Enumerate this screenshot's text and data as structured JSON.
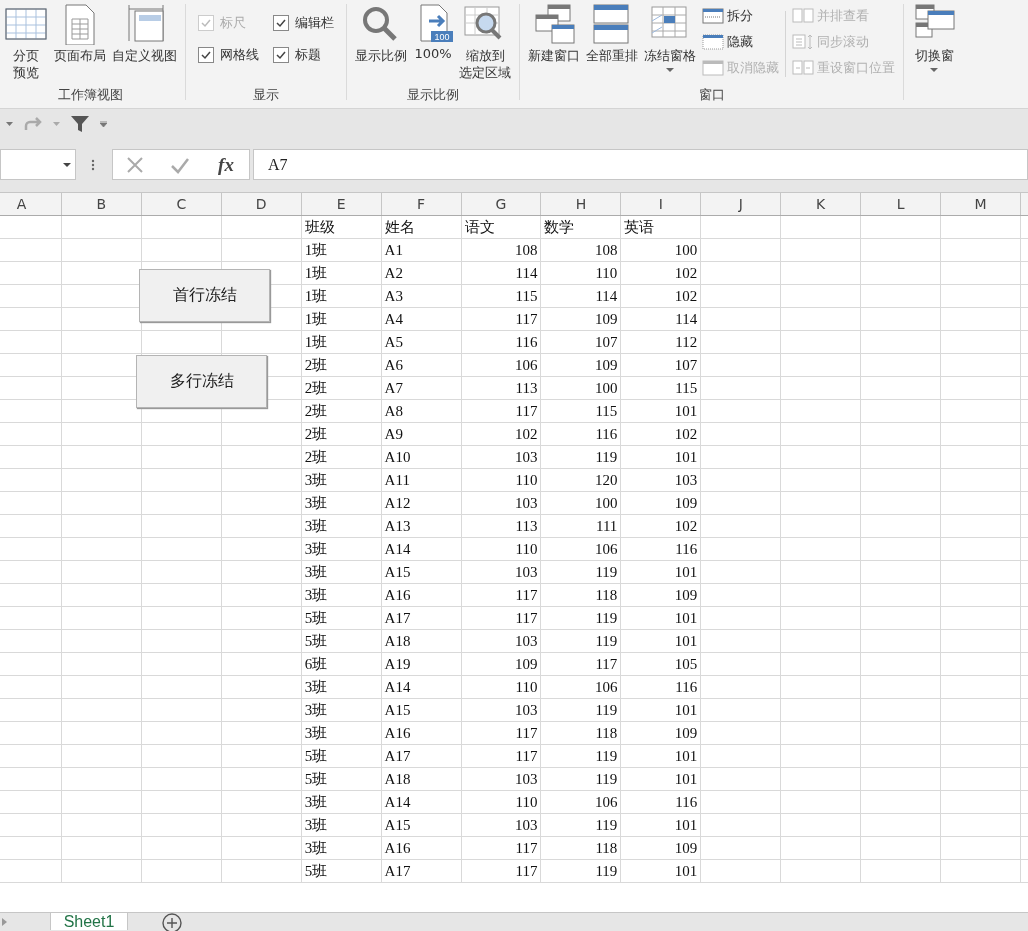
{
  "ribbon": {
    "groups": [
      {
        "label": "工作簿视图",
        "items": [
          {
            "kind": "large",
            "lines": [
              "分页",
              "预览"
            ]
          },
          {
            "kind": "large",
            "lines": [
              "页面布局"
            ]
          },
          {
            "kind": "large",
            "lines": [
              "自定义视图"
            ]
          }
        ]
      },
      {
        "label": "显示",
        "items": [
          {
            "kind": "check",
            "label": "标尺",
            "checked": true,
            "disabled": true
          },
          {
            "kind": "check",
            "label": "网格线",
            "checked": true,
            "disabled": false
          },
          {
            "kind": "check",
            "label": "编辑栏",
            "checked": true,
            "disabled": false
          },
          {
            "kind": "check",
            "label": "标题",
            "checked": true,
            "disabled": false
          }
        ]
      },
      {
        "label": "显示比例",
        "items": [
          {
            "kind": "large",
            "lines": [
              "显示比例"
            ]
          },
          {
            "kind": "large",
            "lines": [
              "100%"
            ],
            "badge": "100"
          },
          {
            "kind": "large",
            "lines": [
              "缩放到",
              "选定区域"
            ]
          }
        ]
      },
      {
        "label": "窗口",
        "items": [
          {
            "kind": "large",
            "lines": [
              "新建窗口"
            ]
          },
          {
            "kind": "large",
            "lines": [
              "全部重排"
            ]
          },
          {
            "kind": "large",
            "lines": [
              "冻结窗格"
            ],
            "dropdown": true
          },
          {
            "kind": "small",
            "label": "拆分",
            "disabled": false
          },
          {
            "kind": "small",
            "label": "隐藏",
            "disabled": false
          },
          {
            "kind": "small",
            "label": "取消隐藏",
            "disabled": true
          },
          {
            "kind": "small",
            "label": "并排查看",
            "disabled": true
          },
          {
            "kind": "small",
            "label": "同步滚动",
            "disabled": true
          },
          {
            "kind": "small",
            "label": "重设窗口位置",
            "disabled": true
          }
        ]
      },
      {
        "items": [
          {
            "kind": "large",
            "lines": [
              "切换窗"
            ],
            "dropdown": true
          }
        ]
      }
    ]
  },
  "formula_bar": {
    "fx": "fx",
    "value": "A7"
  },
  "sheet": {
    "column_headers": [
      "A",
      "B",
      "C",
      "D",
      "E",
      "F",
      "G",
      "H",
      "I",
      "J",
      "K",
      "L",
      "M"
    ],
    "table": {
      "columns": [
        "班级",
        "姓名",
        "语文",
        "数学",
        "英语"
      ],
      "rows": [
        [
          "1班",
          "A1",
          "108",
          "108",
          "100"
        ],
        [
          "1班",
          "A2",
          "114",
          "110",
          "102"
        ],
        [
          "1班",
          "A3",
          "115",
          "114",
          "102"
        ],
        [
          "1班",
          "A4",
          "117",
          "109",
          "114"
        ],
        [
          "1班",
          "A5",
          "116",
          "107",
          "112"
        ],
        [
          "2班",
          "A6",
          "106",
          "109",
          "107"
        ],
        [
          "2班",
          "A7",
          "113",
          "100",
          "115"
        ],
        [
          "2班",
          "A8",
          "117",
          "115",
          "101"
        ],
        [
          "2班",
          "A9",
          "102",
          "116",
          "102"
        ],
        [
          "2班",
          "A10",
          "103",
          "119",
          "101"
        ],
        [
          "3班",
          "A11",
          "110",
          "120",
          "103"
        ],
        [
          "3班",
          "A12",
          "103",
          "100",
          "109"
        ],
        [
          "3班",
          "A13",
          "113",
          "111",
          "102"
        ],
        [
          "3班",
          "A14",
          "110",
          "106",
          "116"
        ],
        [
          "3班",
          "A15",
          "103",
          "119",
          "101"
        ],
        [
          "3班",
          "A16",
          "117",
          "118",
          "109"
        ],
        [
          "5班",
          "A17",
          "117",
          "119",
          "101"
        ],
        [
          "5班",
          "A18",
          "103",
          "119",
          "101"
        ],
        [
          "6班",
          "A19",
          "109",
          "117",
          "105"
        ],
        [
          "3班",
          "A14",
          "110",
          "106",
          "116"
        ],
        [
          "3班",
          "A15",
          "103",
          "119",
          "101"
        ],
        [
          "3班",
          "A16",
          "117",
          "118",
          "109"
        ],
        [
          "5班",
          "A17",
          "117",
          "119",
          "101"
        ],
        [
          "5班",
          "A18",
          "103",
          "119",
          "101"
        ],
        [
          "3班",
          "A14",
          "110",
          "106",
          "116"
        ],
        [
          "3班",
          "A15",
          "103",
          "119",
          "101"
        ],
        [
          "3班",
          "A16",
          "117",
          "118",
          "109"
        ],
        [
          "5班",
          "A17",
          "117",
          "119",
          "101"
        ]
      ]
    },
    "buttons": [
      {
        "label": "首行冻结"
      },
      {
        "label": "多行冻结"
      }
    ]
  },
  "sheet_tabs": [
    {
      "label": "Sheet1",
      "selected": true
    }
  ]
}
